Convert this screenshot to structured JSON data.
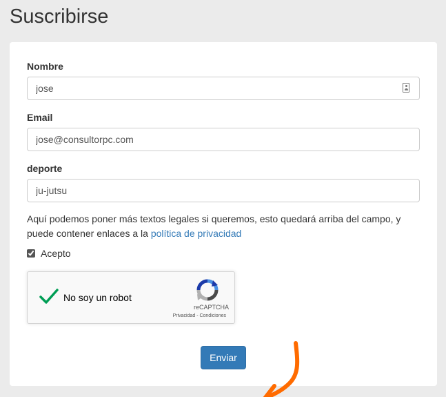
{
  "page": {
    "title": "Suscribirse"
  },
  "form": {
    "name_label": "Nombre",
    "name_value": "jose",
    "email_label": "Email",
    "email_value": "jose@consultorpc.com",
    "sport_label": "deporte",
    "sport_value": "ju-jutsu",
    "legal_text": "Aquí podemos poner más textos legales si queremos, esto quedará arriba del campo, y puede contener enlaces a la ",
    "privacy_link": "política de privacidad",
    "accept_label": "Acepto",
    "accept_checked": true,
    "submit_label": "Enviar"
  },
  "recaptcha": {
    "label": "No soy un robot",
    "brand": "reCAPTCHA",
    "terms": "Privacidad - Condiciones",
    "checked": true
  },
  "icons": {
    "contact": "contact-card-icon",
    "check": "checkmark-icon",
    "recaptcha_logo": "recaptcha-logo-icon",
    "annotation_arrow": "arrow-annotation-icon"
  },
  "colors": {
    "background": "#ebebeb",
    "link": "#337ab7",
    "button": "#337ab7",
    "check": "#009e55",
    "arrow": "#ff6b00"
  }
}
